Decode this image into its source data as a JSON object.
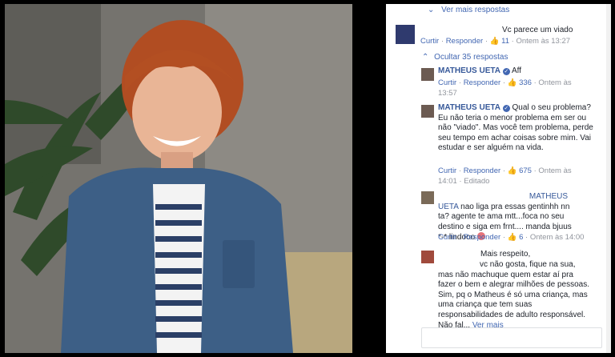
{
  "thread": {
    "ver_mais_respostas_top": "Ver mais respostas",
    "ocultar_respostas": "Ocultar 35 respostas"
  },
  "comments": [
    {
      "text": "Vc parece um viado",
      "curtir": "Curtir",
      "responder": "Responder",
      "likes": "11",
      "time": "Ontem às 13:27"
    },
    {
      "author": "MATHEUS UETA",
      "text": "Aff",
      "curtir": "Curtir",
      "responder": "Responder",
      "likes": "336",
      "time": "Ontem às 13:57"
    },
    {
      "author": "MATHEUS UETA",
      "text": "Qual o seu problema? Eu não teria o menor problema em ser ou não \"viado\". Mas você tem problema, perde seu tempo em achar coisas sobre mim. Vai estudar e ser alguém na vida.",
      "curtir": "Curtir",
      "responder": "Responder",
      "likes": "675",
      "time": "Ontem às 14:01",
      "edited": "Editado"
    },
    {
      "mention": "MATHEUS UETA",
      "text": "nao liga pra essas gentinhh nn ta? agente te ama mtt...foca no seu destino e siga em frnt.... manda bjuus *-* lindooo",
      "curtir": "Curtir",
      "responder": "Responder",
      "likes": "6",
      "time": "Ontem às 14:00"
    },
    {
      "line1": "Mais respeito,",
      "text": "vc não gosta, fique na sua, mas não machuque quem estar aí pra fazer o bem e alegrar milhões de pessoas. Sim, pq o Matheus é só uma criança, mas uma criança que tem suas responsabilidades de adulto responsável. Não fal...",
      "ver_mais": "Ver mais"
    }
  ],
  "colors": {
    "link": "#4267b2",
    "name": "#365899",
    "muted": "#90949c",
    "background": "#000000",
    "heart": "#e5737a"
  },
  "icons": [
    "chevron-down-icon",
    "chevron-up-icon",
    "like-icon",
    "verified-icon",
    "heart-icon"
  ]
}
